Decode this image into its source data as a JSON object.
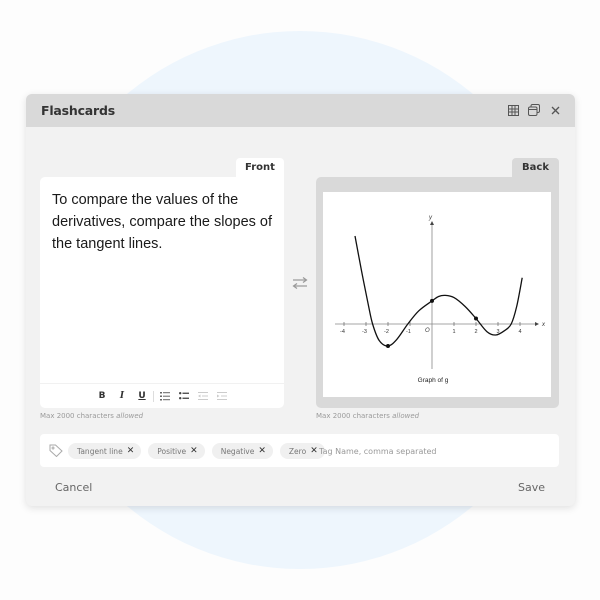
{
  "window": {
    "title": "Flashcards",
    "icons": [
      "grid-view-icon",
      "windows-icon",
      "close-icon"
    ]
  },
  "front": {
    "tab_label": "Front",
    "text": "To compare the values of the derivatives, compare the slopes of the tangent lines.",
    "toolbar": {
      "bold": "B",
      "italic": "I",
      "underline": "U",
      "items": [
        "bold",
        "italic",
        "underline",
        "numbered-list",
        "bulleted-list",
        "outdent",
        "indent"
      ]
    },
    "hint_prefix": "Max 2000 characters",
    "hint_suffix": "allowed"
  },
  "swap": {
    "icon": "swap-arrows-icon"
  },
  "back": {
    "tab_label": "Back",
    "hint_prefix": "Max 2000 characters",
    "hint_suffix": "allowed",
    "graph": {
      "caption": "Graph of g",
      "x_axis_label": "x",
      "y_axis_label": "y",
      "origin_label": "O",
      "x_ticks": [
        "-4",
        "-3",
        "-2",
        "-1",
        "1",
        "2",
        "3",
        "4"
      ]
    }
  },
  "chart_data": {
    "type": "line",
    "title": "Graph of g",
    "xlabel": "x",
    "ylabel": "y",
    "xlim": [
      -4.4,
      4.6
    ],
    "ylim": [
      -2,
      4.6
    ],
    "x_ticks": [
      -4,
      -3,
      -2,
      -1,
      1,
      2,
      3,
      4
    ],
    "grid": false,
    "series": [
      {
        "name": "g",
        "x": [
          -3.5,
          -3.2,
          -2.9,
          -2.7,
          -2.4,
          -2.0,
          -1.6,
          -1.1,
          -0.6,
          0.0,
          0.3,
          0.6,
          1.0,
          1.5,
          2.0,
          2.5,
          2.9,
          3.3,
          3.6,
          3.85,
          4.1
        ],
        "y": [
          4.0,
          2.4,
          0.9,
          0.0,
          -0.75,
          -1.0,
          -0.7,
          0.0,
          0.6,
          1.05,
          1.25,
          1.3,
          1.2,
          0.8,
          0.25,
          -0.35,
          -0.5,
          -0.3,
          0.0,
          0.8,
          2.1
        ]
      }
    ],
    "marked_points": [
      {
        "x": -2,
        "y": -1.0
      },
      {
        "x": 0,
        "y": 1.05
      },
      {
        "x": 2,
        "y": 0.25
      }
    ]
  },
  "tags": {
    "items": [
      "Tangent line",
      "Positive",
      "Negative",
      "Zero"
    ],
    "remove_glyph": "✕",
    "input_placeholder": "Tag Name, comma separated",
    "input_value": ""
  },
  "footer": {
    "cancel_label": "Cancel",
    "save_label": "Save"
  }
}
